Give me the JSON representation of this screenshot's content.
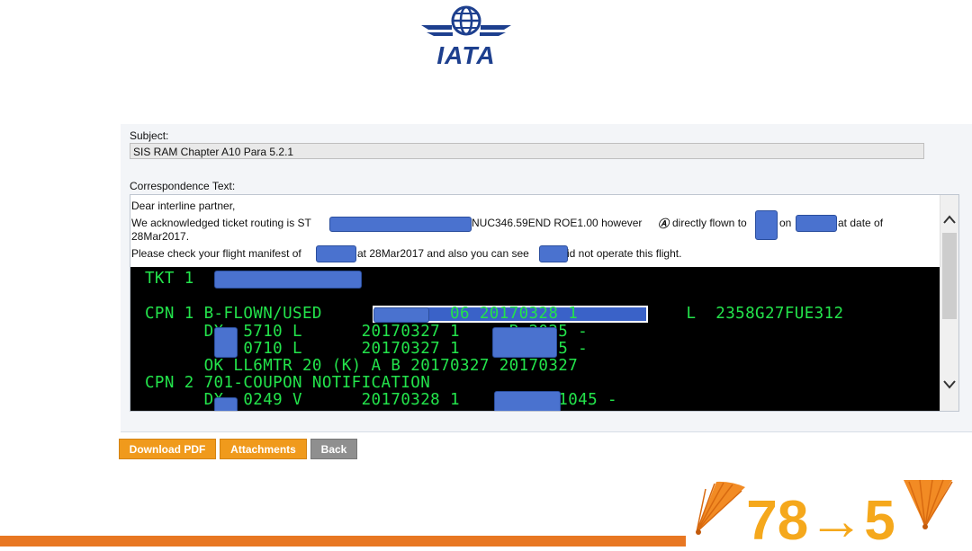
{
  "logo": {
    "text": "IATA"
  },
  "subject": {
    "label": "Subject:",
    "value": "SIS RAM Chapter A10 Para 5.2.1"
  },
  "correspondence": {
    "label": "Correspondence Text:",
    "greeting": "Dear interline partner,",
    "line2": {
      "part1": "We acknowledged ticket routing is ST",
      "part2": "NUC346.59END ROE1.00  however",
      "part3": "directly flown to",
      "part4": "on",
      "part5": "at date of"
    },
    "line3": "28Mar2017.",
    "line4": {
      "part1": "Please check your flight manifest of",
      "part2": "at 28Mar2017 and also you can see",
      "part3": "id not operate this flight."
    }
  },
  "terminal": {
    "lines": [
      "TKT 1",
      "CPN 1 B-FLOWN/USED             06 20170328 1           L  2358G27FUE312",
      "      DX  5710 L      20170327 1     B 2025 -",
      "          0710 L      20170327 1     B 2025 -",
      "      OK LL6MTR 20 (K) A B 20170327 20170327",
      "CPN 2 701-COUPON NOTIFICATION",
      "      DX  0249 V      20170328 1          1045 -"
    ]
  },
  "buttons": {
    "download_pdf": "Download PDF",
    "attachments": "Attachments",
    "back": "Back"
  },
  "badge": {
    "text": "78→5"
  },
  "colors": {
    "accent_orange": "#F09A1C",
    "terminal_green": "#23E34B",
    "redact_blue": "#4A72CF",
    "iata_blue": "#1D3F8E"
  }
}
